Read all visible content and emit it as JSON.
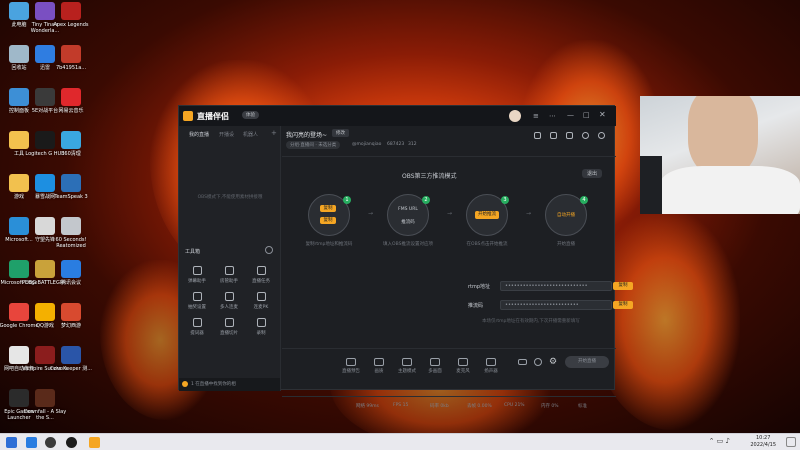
{
  "desktop": {
    "col1": [
      {
        "label": "此电脑",
        "icon": "computer-icon",
        "color": "#4aa3df"
      },
      {
        "label": "回收站",
        "icon": "recycle-bin-icon",
        "color": "#9fb8c9"
      },
      {
        "label": "控制面板",
        "icon": "control-panel-icon",
        "color": "#3d8fd6"
      },
      {
        "label": "工具",
        "icon": "folder-icon",
        "color": "#f2c14e"
      },
      {
        "label": "游戏",
        "icon": "folder-icon",
        "color": "#f2c14e"
      },
      {
        "label": "Microsoft...",
        "icon": "edge-icon",
        "color": "#2a8fd8"
      },
      {
        "label": "Microsoft Edge",
        "icon": "edge-icon",
        "color": "#1fa06a"
      },
      {
        "label": "Google Chrome",
        "icon": "chrome-icon",
        "color": "#e8453c"
      },
      {
        "label": "网吧自动修复",
        "icon": "document-icon",
        "color": "#e6e6e6"
      },
      {
        "label": "Epic Games Launcher",
        "icon": "epic-icon",
        "color": "#2b2b2b"
      }
    ],
    "col2": [
      {
        "label": "Tiny Tina's Wonderla...",
        "icon": "game-icon",
        "color": "#7a4fc2"
      },
      {
        "label": "迅雷",
        "icon": "thunder-icon",
        "color": "#2f7de1"
      },
      {
        "label": "5E对战平台",
        "icon": "game-icon",
        "color": "#3a3a3a"
      },
      {
        "label": "Logitech G HUB",
        "icon": "logitech-icon",
        "color": "#1a1a1a"
      },
      {
        "label": "暴雪战网",
        "icon": "battlenet-icon",
        "color": "#1d8fe1"
      },
      {
        "label": "守望先锋",
        "icon": "overwatch-icon",
        "color": "#d8d8d8"
      },
      {
        "label": "PUBG BATTLEGR...",
        "icon": "pubg-icon",
        "color": "#c9a23a"
      },
      {
        "label": "QQ游戏",
        "icon": "qq-icon",
        "color": "#f4b000"
      },
      {
        "label": "Vampire Survivors",
        "icon": "game-icon",
        "color": "#8b1d1d"
      },
      {
        "label": "Downfall - A Slay the S...",
        "icon": "game-icon",
        "color": "#5a2a1a"
      }
    ],
    "col3": [
      {
        "label": "Apex Legends",
        "icon": "apex-icon",
        "color": "#b8211e"
      },
      {
        "label": "7b41951a...",
        "icon": "file-icon",
        "color": "#c23b2a"
      },
      {
        "label": "网易云音乐",
        "icon": "music-icon",
        "color": "#e0282c"
      },
      {
        "label": "360清理",
        "icon": "clean-icon",
        "color": "#3aa7e0"
      },
      {
        "label": "TeamSpeak 3",
        "icon": "teamspeak-icon",
        "color": "#2c6fb7"
      },
      {
        "label": "60 Seconds! Reatomized",
        "icon": "game-icon",
        "color": "#c3c7cc"
      },
      {
        "label": "腾讯会议",
        "icon": "meeting-icon",
        "color": "#2a7de1"
      },
      {
        "label": "梦幻西游",
        "icon": "game-icon",
        "color": "#d84a2f"
      },
      {
        "label": "Core Keeper 测...",
        "icon": "game-icon",
        "color": "#2a55a8"
      }
    ]
  },
  "taskbar": {
    "time": "10:27",
    "date": "2022/4/15"
  },
  "app": {
    "name": "直播伴侣",
    "badge": "体验",
    "left_tabs": [
      "我的直播",
      "开播设",
      "机器人"
    ],
    "left_add": "+",
    "left_empty": "OBS模式下,不能使用素材拼接哦",
    "toolbox_label": "工具箱",
    "tools": [
      "弹幕助手",
      "房管助手",
      "直播任务",
      "抽奖设置",
      "多人连麦",
      "连麦PK",
      "提词器",
      "直播切片",
      "录制"
    ],
    "footer_left": "1 在直播中找到你的相",
    "room_title": "我闪亮的登场~",
    "room_edit": "修改",
    "room_category": "分组·直播间 · 未选分类",
    "room_user": "@mojianqiao",
    "room_id": "687423",
    "room_fans": "312",
    "obs_title": "OBS第三方推流模式",
    "exit": "退出",
    "steps": [
      {
        "num": "1",
        "caption": "复制rtmp地址和推流码",
        "btn1": "复制",
        "btn2": "复制"
      },
      {
        "num": "2",
        "caption": "填入OBS推流设置对应项",
        "inner1": "FMS URL",
        "inner2": "推流码"
      },
      {
        "num": "3",
        "caption": "在OBS点击开始推流",
        "btn1": "开始推流"
      },
      {
        "num": "4",
        "caption": "开始直播",
        "btn1": "自动开播"
      }
    ],
    "rtmp_label": "rtmp地址",
    "rtmp_value": "••••••••••••••••••••••••••••",
    "rtmp_copy": "复制",
    "key_label": "推流码",
    "key_value": "•••••••••••••••••••••••••",
    "key_copy": "复制",
    "note": "本场仅rtmp地址在有效期内,下次开播需重新填写",
    "bottom_tools": [
      "直播预告",
      "画质",
      "主题模式",
      "多画面",
      "麦克风",
      "扬声器"
    ],
    "start_btn": "开始直播",
    "stats": [
      "网络 99ms",
      "FPS 15",
      "码率 0kb",
      "丢帧 0.00%",
      "CPU 21%",
      "内存 0%",
      "标准"
    ]
  }
}
